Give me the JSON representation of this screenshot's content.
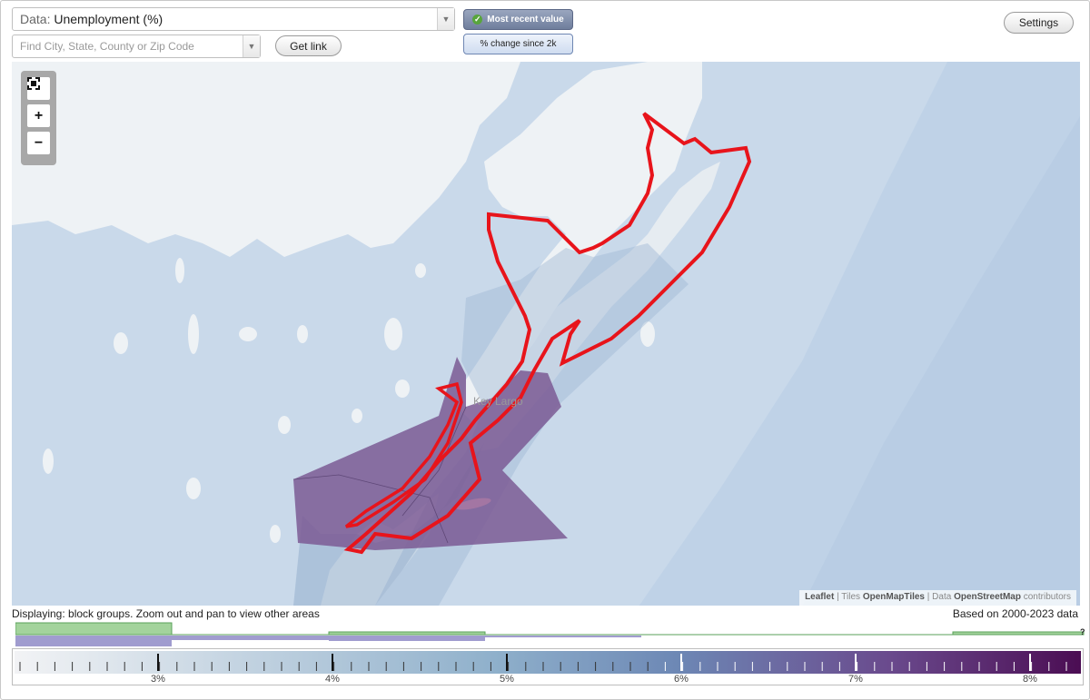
{
  "controls": {
    "data_label": "Data:",
    "data_value": "Unemployment (%)",
    "search_placeholder": "Find City, State, County or Zip Code",
    "get_link": "Get link",
    "mode_recent": "Most recent value",
    "mode_change": "% change since 2k",
    "settings": "Settings"
  },
  "map": {
    "place_label": "Key Largo",
    "attribution": {
      "leaflet": "Leaflet",
      "tiles_prefix": "Tiles",
      "tiles_name": "OpenMapTiles",
      "data_prefix": "Data",
      "data_name": "OpenStreetMap",
      "data_suffix": "contributors"
    },
    "colors": {
      "water": "#c9d9ea",
      "land": "#eef2f5",
      "selected_outline": "#e8141b",
      "blockgroup_high": "#7b5b94"
    },
    "icons": {
      "fullscreen": "fullscreen-icon",
      "zoom_in": "plus-icon",
      "zoom_out": "minus-icon"
    }
  },
  "footer": {
    "displaying": "Displaying: block groups. Zoom out and pan to view other areas",
    "based_on": "Based on 2000-2023 data",
    "help": "?"
  },
  "legend": {
    "tick_labels": [
      "3%",
      "4%",
      "5%",
      "6%",
      "7%",
      "8%"
    ],
    "color_start": "#f2f3f5",
    "color_mid": "#6d88b5",
    "color_end": "#4b0d53"
  }
}
